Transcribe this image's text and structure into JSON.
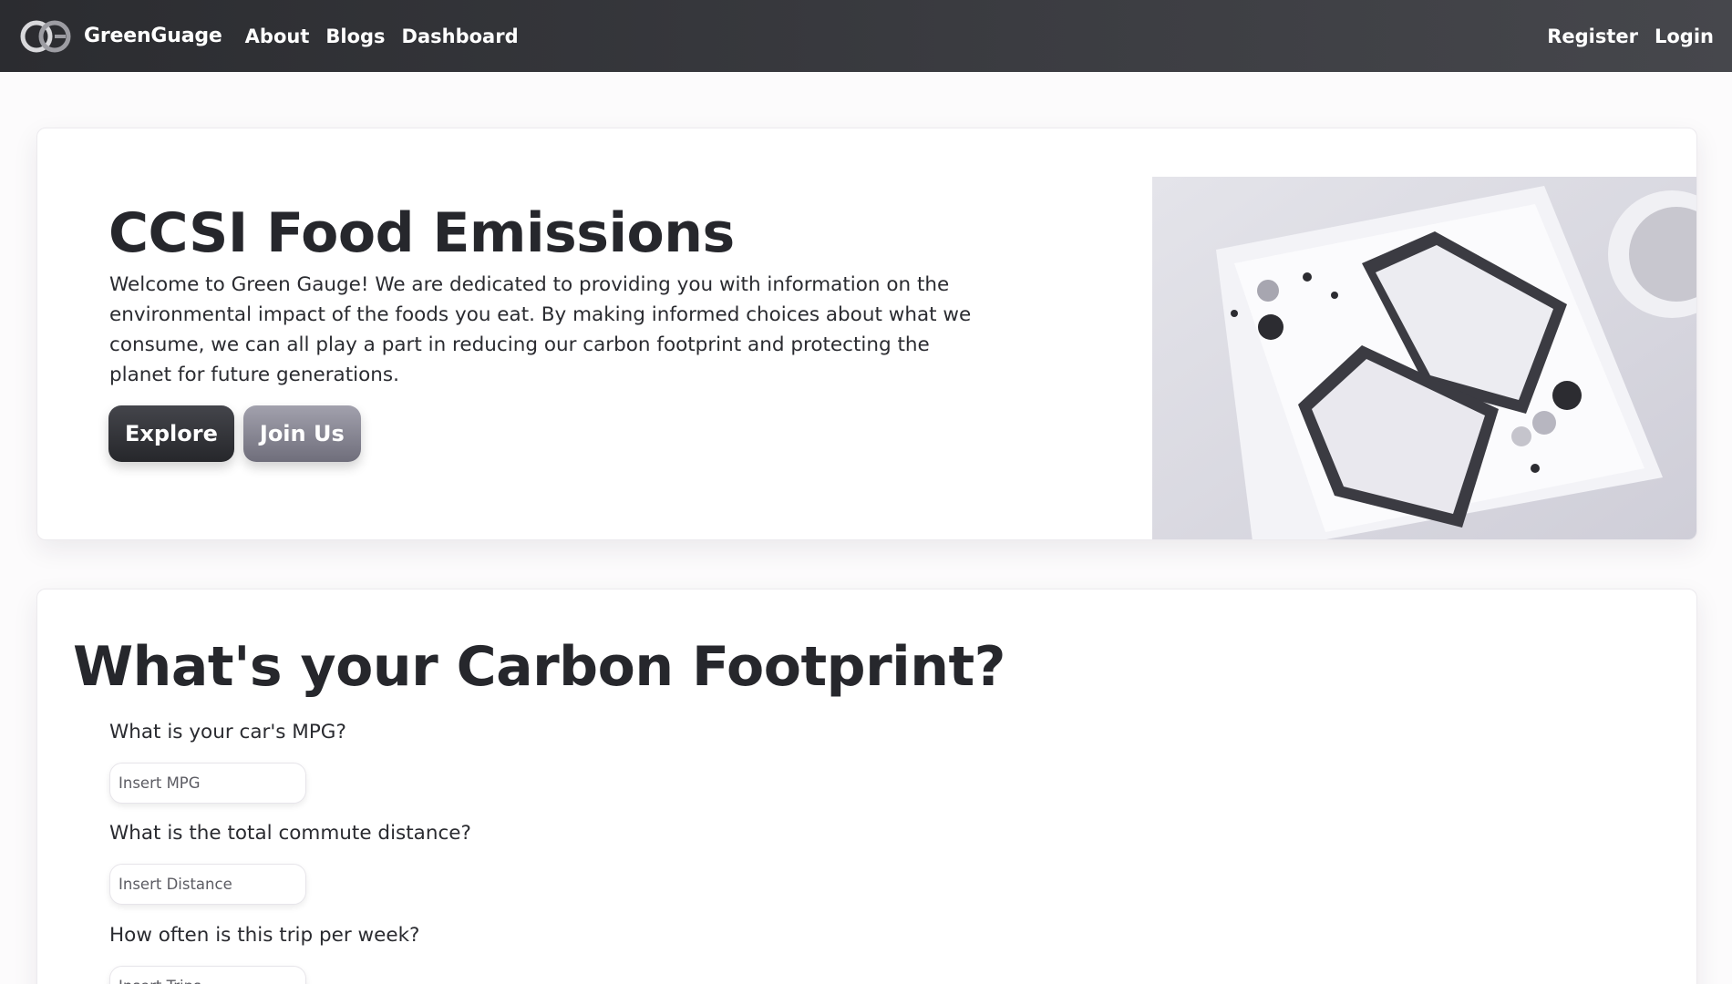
{
  "navbar": {
    "brand": "GreenGuage",
    "links": [
      "About",
      "Blogs",
      "Dashboard"
    ],
    "right_links": [
      "Register",
      "Login"
    ]
  },
  "hero": {
    "title": "CCSI Food Emissions",
    "description": "Welcome to Green Gauge! We are dedicated to providing you with information on the environmental impact of the foods you eat. By making informed choices about what we consume, we can all play a part in reducing our carbon footprint and protecting the planet for future generations.",
    "primary_button": "Explore",
    "secondary_button": "Join Us",
    "image_icon": "food-plate-photo"
  },
  "calculator": {
    "title": "What's your Carbon Footprint?",
    "questions": [
      {
        "label": "What is your car's MPG?",
        "placeholder": "Insert MPG"
      },
      {
        "label": "What is the total commute distance?",
        "placeholder": "Insert Distance"
      },
      {
        "label": "How often is this trip per week?",
        "placeholder": "Insert Trips"
      }
    ]
  },
  "colors": {
    "navbar": "#2b2c30",
    "primary_button": "#2e2f33",
    "secondary_button": "#8a8996",
    "background": "#fcfbfc"
  }
}
